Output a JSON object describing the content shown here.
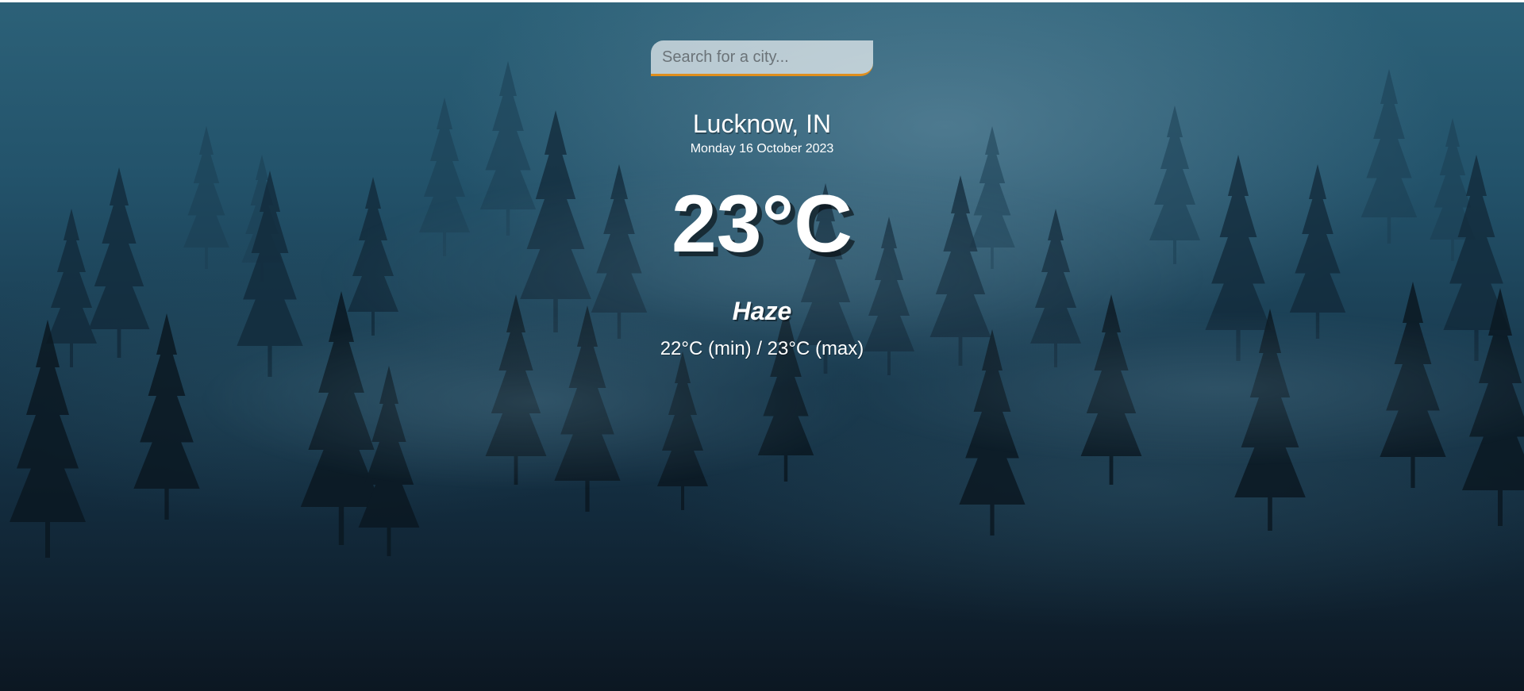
{
  "search": {
    "placeholder": "Search for a city...",
    "value": ""
  },
  "location": {
    "city": "Lucknow, IN",
    "date": "Monday 16 October 2023"
  },
  "current": {
    "temperature": "23°C",
    "condition": "Haze",
    "hi_low": "22°C (min) / 23°C (max)"
  },
  "colors": {
    "search_accent": "#df8e1d",
    "text": "#ffffff"
  },
  "background": {
    "icon": "foggy-forest-background"
  }
}
